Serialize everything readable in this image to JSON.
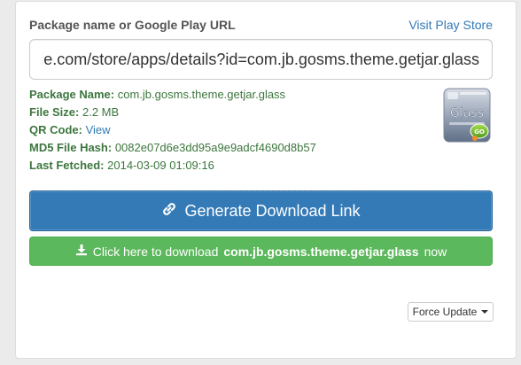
{
  "form": {
    "label": "Package name or Google Play URL",
    "visit_link": "Visit Play Store",
    "url_value": "https://play.google.com/store/apps/details?id=com.jb.gosms.theme.getjar.glass"
  },
  "info": {
    "package_name_label": "Package Name:",
    "package_name_value": "com.jb.gosms.theme.getjar.glass",
    "file_size_label": "File Size:",
    "file_size_value": "2.2 MB",
    "qr_code_label": "QR Code:",
    "qr_code_link": "View",
    "md5_label": "MD5 File Hash:",
    "md5_value": "0082e07d6e3dd95a9e9adcf4690d8b57",
    "last_fetched_label": "Last Fetched:",
    "last_fetched_value": "2014-03-09 01:09:16"
  },
  "app_icon": {
    "text": "Glass",
    "badge": "GO"
  },
  "buttons": {
    "generate_label": "Generate Download Link",
    "download_prefix": "Click here to download",
    "download_package": "com.jb.gosms.theme.getjar.glass",
    "download_suffix": "now",
    "force_update_label": "Force Update"
  },
  "icons": {
    "generate": "link-icon",
    "download": "download-icon",
    "force_update": "caret-down-icon"
  },
  "colors": {
    "primary": "#337ab7",
    "success": "#5cb85c",
    "info_text": "#3c763d",
    "link": "#337ab7"
  }
}
